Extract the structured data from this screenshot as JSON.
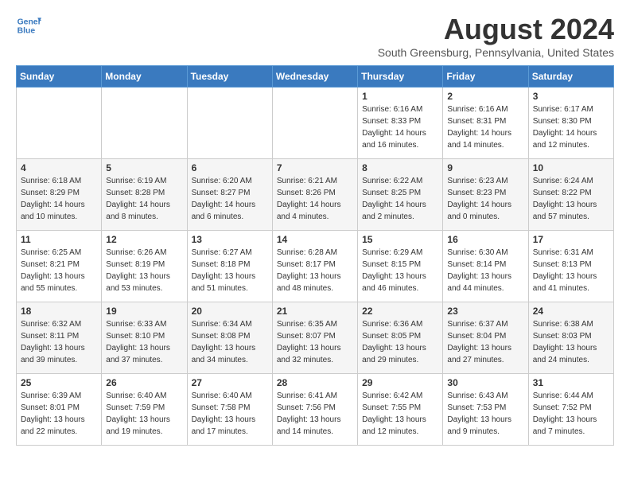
{
  "header": {
    "logo_line1": "General",
    "logo_line2": "Blue",
    "month": "August 2024",
    "location": "South Greensburg, Pennsylvania, United States"
  },
  "weekdays": [
    "Sunday",
    "Monday",
    "Tuesday",
    "Wednesday",
    "Thursday",
    "Friday",
    "Saturday"
  ],
  "weeks": [
    [
      {
        "day": "",
        "info": ""
      },
      {
        "day": "",
        "info": ""
      },
      {
        "day": "",
        "info": ""
      },
      {
        "day": "",
        "info": ""
      },
      {
        "day": "1",
        "info": "Sunrise: 6:16 AM\nSunset: 8:33 PM\nDaylight: 14 hours\nand 16 minutes."
      },
      {
        "day": "2",
        "info": "Sunrise: 6:16 AM\nSunset: 8:31 PM\nDaylight: 14 hours\nand 14 minutes."
      },
      {
        "day": "3",
        "info": "Sunrise: 6:17 AM\nSunset: 8:30 PM\nDaylight: 14 hours\nand 12 minutes."
      }
    ],
    [
      {
        "day": "4",
        "info": "Sunrise: 6:18 AM\nSunset: 8:29 PM\nDaylight: 14 hours\nand 10 minutes."
      },
      {
        "day": "5",
        "info": "Sunrise: 6:19 AM\nSunset: 8:28 PM\nDaylight: 14 hours\nand 8 minutes."
      },
      {
        "day": "6",
        "info": "Sunrise: 6:20 AM\nSunset: 8:27 PM\nDaylight: 14 hours\nand 6 minutes."
      },
      {
        "day": "7",
        "info": "Sunrise: 6:21 AM\nSunset: 8:26 PM\nDaylight: 14 hours\nand 4 minutes."
      },
      {
        "day": "8",
        "info": "Sunrise: 6:22 AM\nSunset: 8:25 PM\nDaylight: 14 hours\nand 2 minutes."
      },
      {
        "day": "9",
        "info": "Sunrise: 6:23 AM\nSunset: 8:23 PM\nDaylight: 14 hours\nand 0 minutes."
      },
      {
        "day": "10",
        "info": "Sunrise: 6:24 AM\nSunset: 8:22 PM\nDaylight: 13 hours\nand 57 minutes."
      }
    ],
    [
      {
        "day": "11",
        "info": "Sunrise: 6:25 AM\nSunset: 8:21 PM\nDaylight: 13 hours\nand 55 minutes."
      },
      {
        "day": "12",
        "info": "Sunrise: 6:26 AM\nSunset: 8:19 PM\nDaylight: 13 hours\nand 53 minutes."
      },
      {
        "day": "13",
        "info": "Sunrise: 6:27 AM\nSunset: 8:18 PM\nDaylight: 13 hours\nand 51 minutes."
      },
      {
        "day": "14",
        "info": "Sunrise: 6:28 AM\nSunset: 8:17 PM\nDaylight: 13 hours\nand 48 minutes."
      },
      {
        "day": "15",
        "info": "Sunrise: 6:29 AM\nSunset: 8:15 PM\nDaylight: 13 hours\nand 46 minutes."
      },
      {
        "day": "16",
        "info": "Sunrise: 6:30 AM\nSunset: 8:14 PM\nDaylight: 13 hours\nand 44 minutes."
      },
      {
        "day": "17",
        "info": "Sunrise: 6:31 AM\nSunset: 8:13 PM\nDaylight: 13 hours\nand 41 minutes."
      }
    ],
    [
      {
        "day": "18",
        "info": "Sunrise: 6:32 AM\nSunset: 8:11 PM\nDaylight: 13 hours\nand 39 minutes."
      },
      {
        "day": "19",
        "info": "Sunrise: 6:33 AM\nSunset: 8:10 PM\nDaylight: 13 hours\nand 37 minutes."
      },
      {
        "day": "20",
        "info": "Sunrise: 6:34 AM\nSunset: 8:08 PM\nDaylight: 13 hours\nand 34 minutes."
      },
      {
        "day": "21",
        "info": "Sunrise: 6:35 AM\nSunset: 8:07 PM\nDaylight: 13 hours\nand 32 minutes."
      },
      {
        "day": "22",
        "info": "Sunrise: 6:36 AM\nSunset: 8:05 PM\nDaylight: 13 hours\nand 29 minutes."
      },
      {
        "day": "23",
        "info": "Sunrise: 6:37 AM\nSunset: 8:04 PM\nDaylight: 13 hours\nand 27 minutes."
      },
      {
        "day": "24",
        "info": "Sunrise: 6:38 AM\nSunset: 8:03 PM\nDaylight: 13 hours\nand 24 minutes."
      }
    ],
    [
      {
        "day": "25",
        "info": "Sunrise: 6:39 AM\nSunset: 8:01 PM\nDaylight: 13 hours\nand 22 minutes."
      },
      {
        "day": "26",
        "info": "Sunrise: 6:40 AM\nSunset: 7:59 PM\nDaylight: 13 hours\nand 19 minutes."
      },
      {
        "day": "27",
        "info": "Sunrise: 6:40 AM\nSunset: 7:58 PM\nDaylight: 13 hours\nand 17 minutes."
      },
      {
        "day": "28",
        "info": "Sunrise: 6:41 AM\nSunset: 7:56 PM\nDaylight: 13 hours\nand 14 minutes."
      },
      {
        "day": "29",
        "info": "Sunrise: 6:42 AM\nSunset: 7:55 PM\nDaylight: 13 hours\nand 12 minutes."
      },
      {
        "day": "30",
        "info": "Sunrise: 6:43 AM\nSunset: 7:53 PM\nDaylight: 13 hours\nand 9 minutes."
      },
      {
        "day": "31",
        "info": "Sunrise: 6:44 AM\nSunset: 7:52 PM\nDaylight: 13 hours\nand 7 minutes."
      }
    ]
  ]
}
